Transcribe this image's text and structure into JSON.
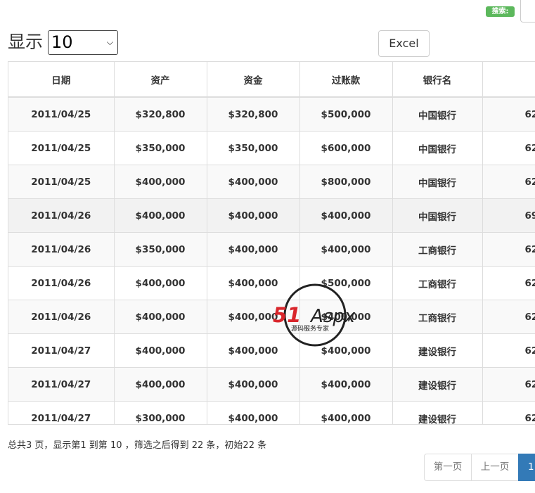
{
  "search": {
    "label": "搜索:"
  },
  "length": {
    "label": "显示",
    "selected": "10"
  },
  "buttons": {
    "excel": "Excel"
  },
  "table": {
    "headers": [
      "日期",
      "资产",
      "资金",
      "过账款",
      "银行名",
      ""
    ],
    "rows": [
      [
        "2011/04/25",
        "$320,800",
        "$320,800",
        "$500,000",
        "中国银行",
        "62"
      ],
      [
        "2011/04/25",
        "$350,000",
        "$350,000",
        "$600,000",
        "中国银行",
        "62"
      ],
      [
        "2011/04/25",
        "$400,000",
        "$400,000",
        "$800,000",
        "中国银行",
        "62"
      ],
      [
        "2011/04/26",
        "$400,000",
        "$400,000",
        "$400,000",
        "中国银行",
        "69"
      ],
      [
        "2011/04/26",
        "$350,000",
        "$400,000",
        "$400,000",
        "工商银行",
        "62"
      ],
      [
        "2011/04/26",
        "$400,000",
        "$400,000",
        "$500,000",
        "工商银行",
        "62"
      ],
      [
        "2011/04/26",
        "$400,000",
        "$400,000",
        "$400,000",
        "工商银行",
        "62"
      ],
      [
        "2011/04/27",
        "$400,000",
        "$400,000",
        "$400,000",
        "建设银行",
        "62"
      ],
      [
        "2011/04/27",
        "$400,000",
        "$400,000",
        "$400,000",
        "建设银行",
        "62"
      ],
      [
        "2011/04/27",
        "$300,000",
        "$400,000",
        "$400,000",
        "建设银行",
        "62"
      ]
    ]
  },
  "info": "总共3 页，显示第1 到第 10 ，筛选之后得到 22 条，初始22 条",
  "pagination": {
    "first": "第一页",
    "prev": "上一页",
    "current": "1"
  },
  "watermark": {
    "brand": "51Aspx",
    "tagline": "源码服务专家"
  },
  "colors": {
    "badge": "#5cb85c",
    "active_page": "#337ab7",
    "watermark_red": "#d9262c",
    "watermark_green": "#3aa935"
  }
}
